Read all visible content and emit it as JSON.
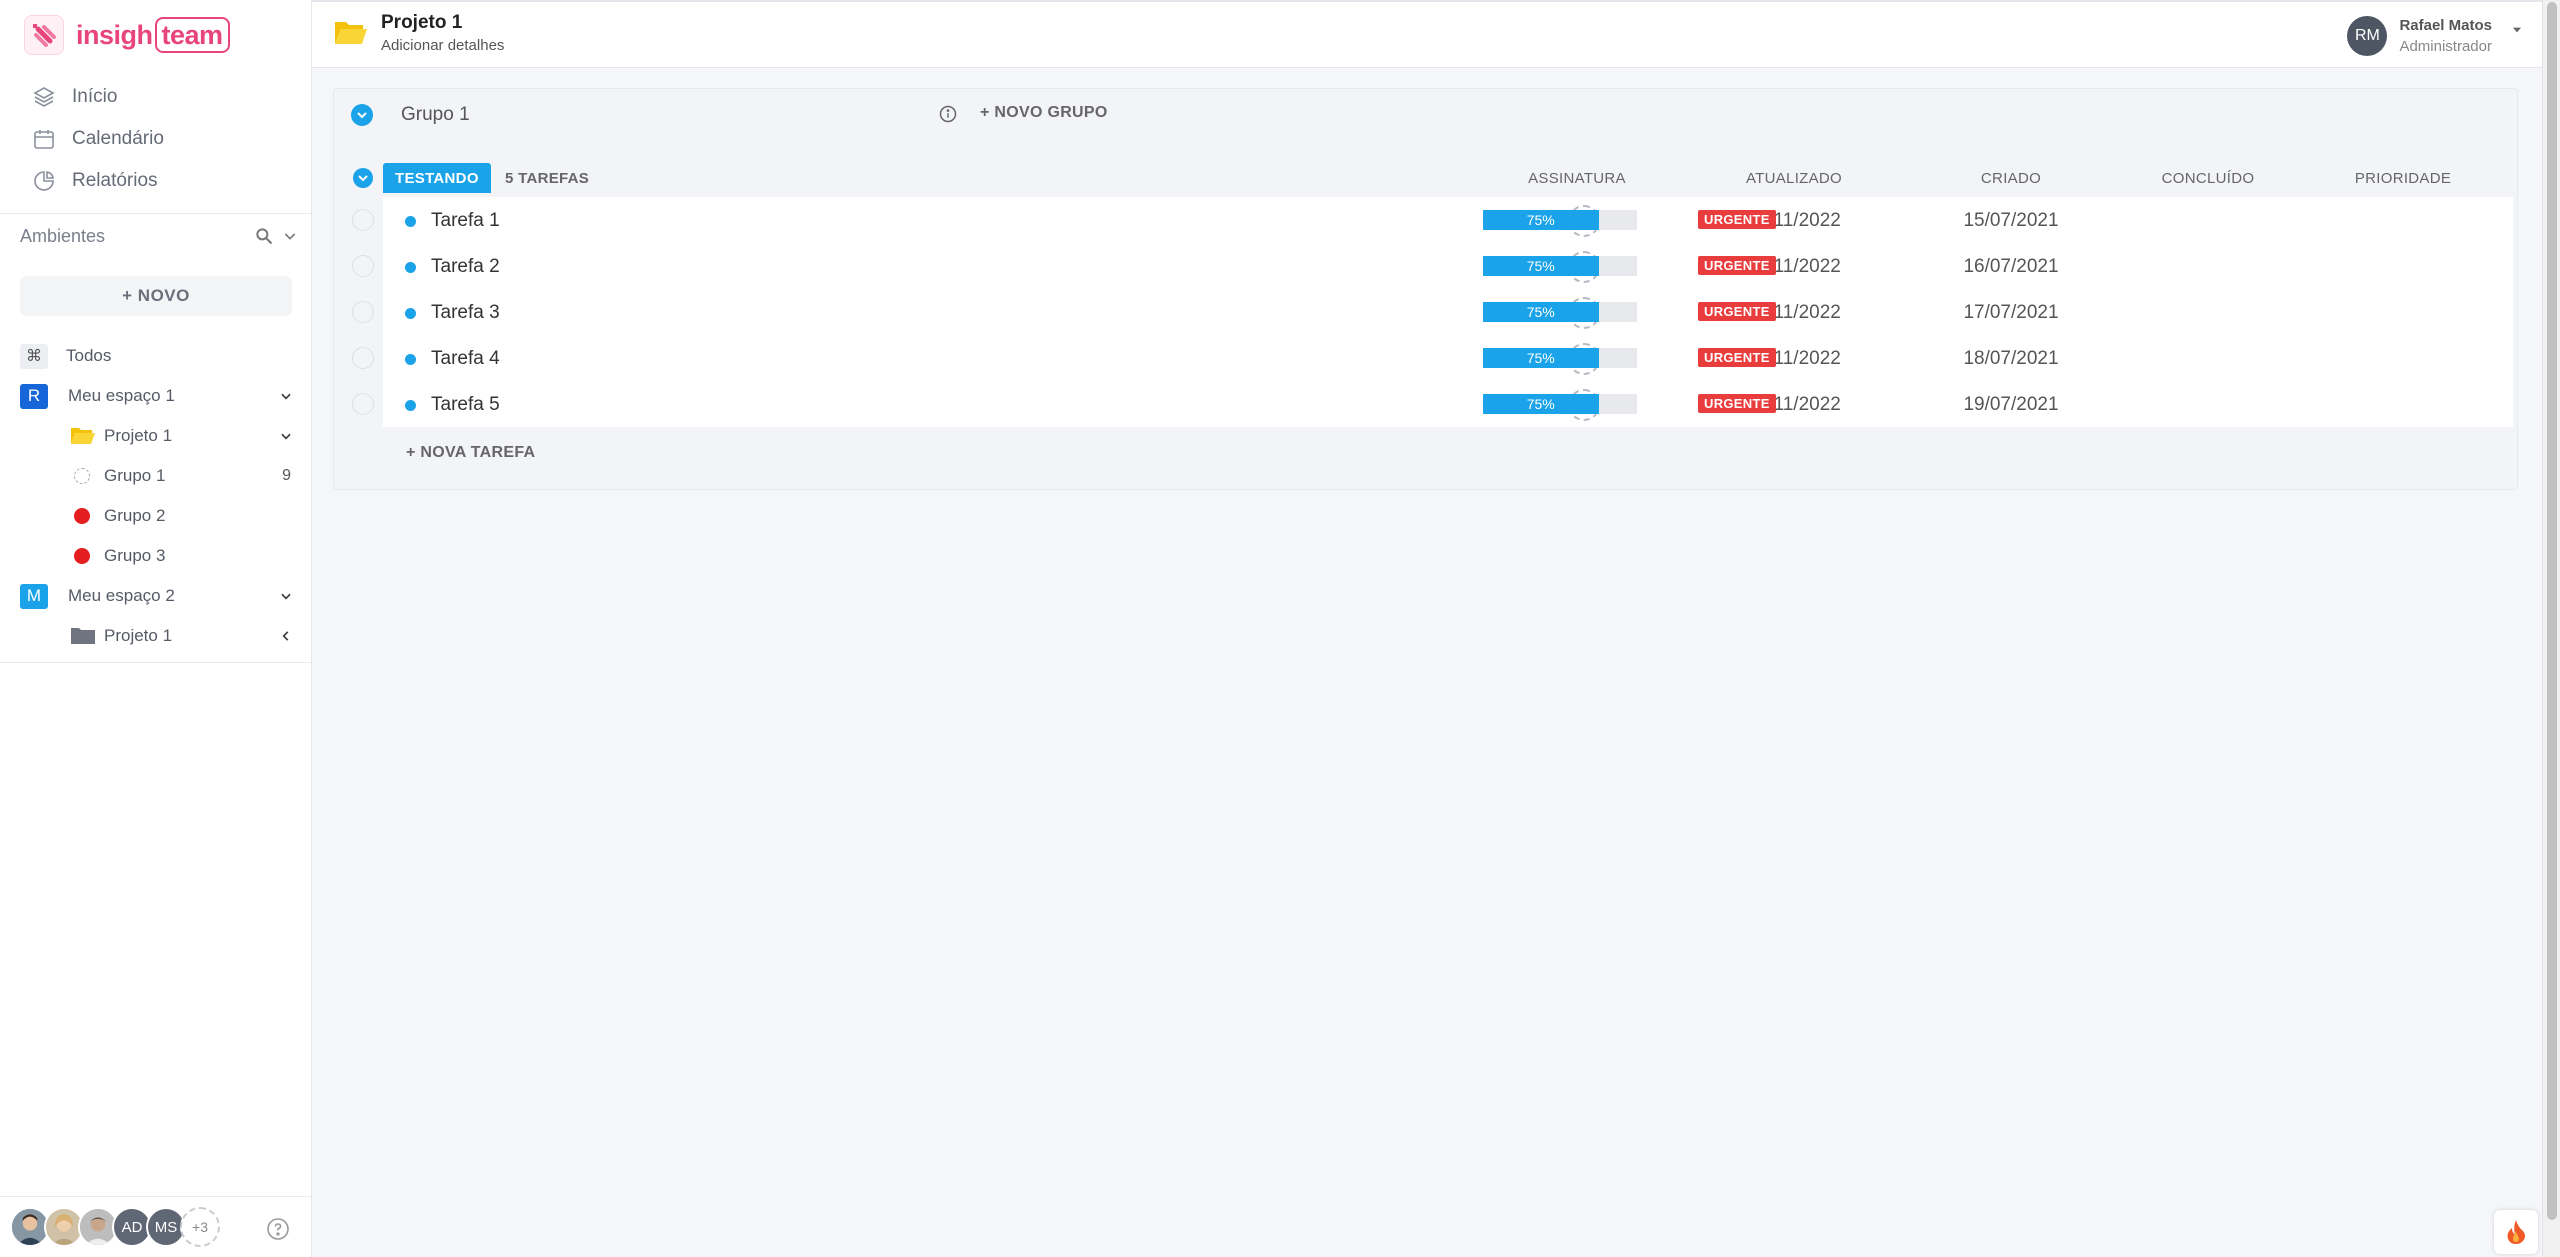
{
  "brand": {
    "logo_left": "insigh",
    "logo_right": "team",
    "color": "#e8457c"
  },
  "sidebar": {
    "nav": [
      {
        "label": "Início",
        "icon": "layers-icon"
      },
      {
        "label": "Calendário",
        "icon": "calendar-icon"
      },
      {
        "label": "Relatórios",
        "icon": "pie-chart-icon"
      }
    ],
    "ambientes_label": "Ambientes",
    "new_button": "+ NOVO",
    "all_label": "Todos",
    "spaces": [
      {
        "badge": "R",
        "badge_color": "#1666d9",
        "name": "Meu espaço 1",
        "projects": [
          {
            "name": "Projeto 1",
            "groups": [
              {
                "name": "Grupo 1",
                "count": "9",
                "color": "#cccccc"
              },
              {
                "name": "Grupo 2",
                "color": "#e41e1e"
              },
              {
                "name": "Grupo 3",
                "color": "#e41e1e"
              }
            ]
          }
        ]
      },
      {
        "badge": "M",
        "badge_color": "#1aa3e8",
        "name": "Meu espaço 2",
        "projects": [
          {
            "name": "Projeto 1"
          }
        ]
      }
    ],
    "footer": {
      "avatars": [
        "AD",
        "MS"
      ],
      "more": "+3"
    }
  },
  "header": {
    "title": "Projeto 1",
    "subtitle": "Adicionar detalhes",
    "user": {
      "initials": "RM",
      "name": "Rafael Matos",
      "role": "Administrador"
    }
  },
  "board": {
    "group_name": "Grupo 1",
    "new_group": "+ NOVO GRUPO",
    "status": "TESTANDO",
    "status_color": "#1aa3e8",
    "task_count": "5 TAREFAS",
    "columns": [
      "ASSINATURA",
      "ATUALIZADO",
      "CRIADO",
      "CONCLUÍDO",
      "PRIORIDADE"
    ],
    "tasks": [
      {
        "name": "Tarefa 1",
        "updated": "03/11/2022",
        "created": "15/07/2021",
        "progress": "75%",
        "progress_value": 0.75,
        "priority": "URGENTE"
      },
      {
        "name": "Tarefa 2",
        "updated": "03/11/2022",
        "created": "16/07/2021",
        "progress": "75%",
        "progress_value": 0.75,
        "priority": "URGENTE"
      },
      {
        "name": "Tarefa 3",
        "updated": "03/11/2022",
        "created": "17/07/2021",
        "progress": "75%",
        "progress_value": 0.75,
        "priority": "URGENTE"
      },
      {
        "name": "Tarefa 4",
        "updated": "03/11/2022",
        "created": "18/07/2021",
        "progress": "75%",
        "progress_value": 0.75,
        "priority": "URGENTE"
      },
      {
        "name": "Tarefa 5",
        "updated": "03/11/2022",
        "created": "19/07/2021",
        "progress": "75%",
        "progress_value": 0.75,
        "priority": "URGENTE"
      }
    ],
    "new_task": "+ NOVA TAREFA",
    "priority_color": "#e93c3c"
  }
}
